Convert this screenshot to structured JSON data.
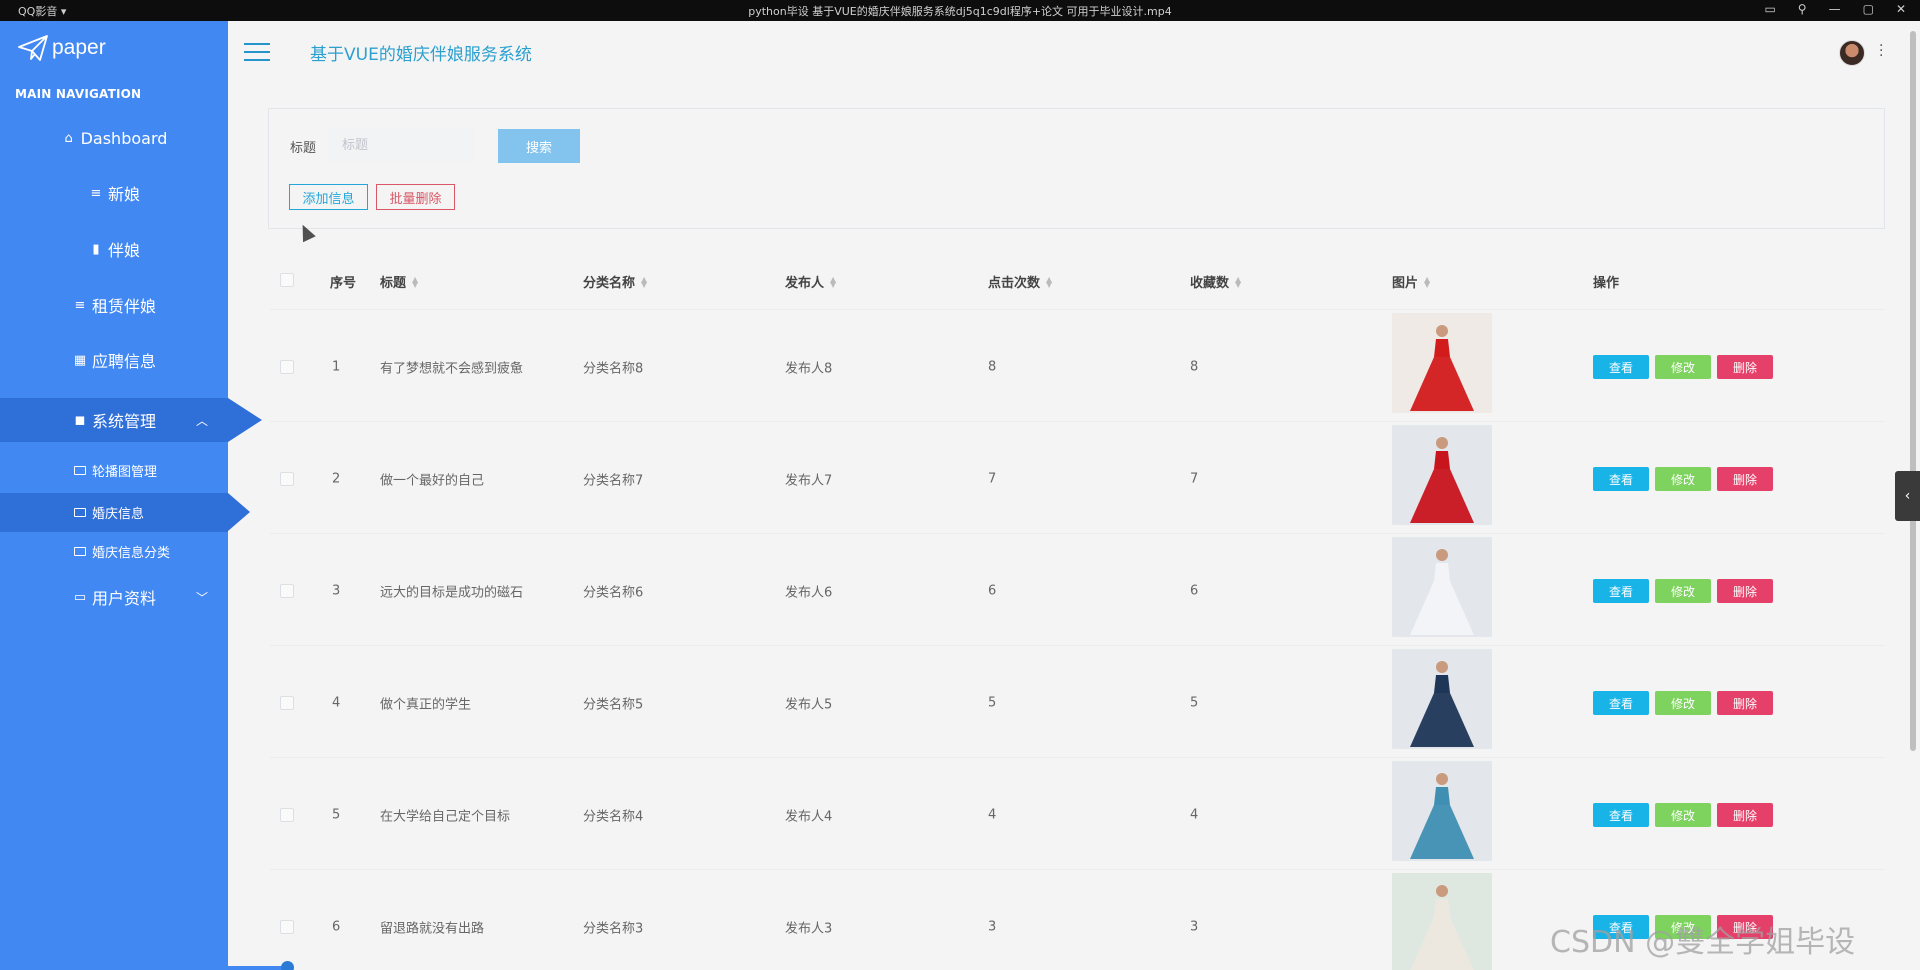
{
  "titlebar": {
    "app": "QQ影音 ▾",
    "file": "python毕设 基于VUE的婚庆伴娘服务系统dj5q1c9dl程序+论文 可用于毕业设计.mp4"
  },
  "sidebar": {
    "brand": "paper",
    "nav_label": "MAIN NAVIGATION",
    "items": [
      {
        "label": "Dashboard"
      },
      {
        "label": "新娘"
      },
      {
        "label": "伴娘"
      },
      {
        "label": "租赁伴娘"
      },
      {
        "label": "应聘信息"
      },
      {
        "label": "系统管理"
      },
      {
        "label": "用户资料"
      }
    ],
    "sub_items": [
      {
        "label": "轮播图管理"
      },
      {
        "label": "婚庆信息"
      },
      {
        "label": "婚庆信息分类"
      }
    ]
  },
  "header": {
    "title": "基于VUE的婚庆伴娘服务系统"
  },
  "search": {
    "label": "标题",
    "placeholder": "标题",
    "search_button": "搜索",
    "add_button": "添加信息",
    "batch_delete_button": "批量删除"
  },
  "table": {
    "columns": [
      "序号",
      "标题",
      "分类名称",
      "发布人",
      "点击次数",
      "收藏数",
      "图片",
      "操作"
    ],
    "action_labels": {
      "view": "查看",
      "edit": "修改",
      "delete": "删除"
    },
    "rows": [
      {
        "index": "1",
        "title": "有了梦想就不会感到疲惫",
        "category": "分类名称8",
        "publisher": "发布人8",
        "clicks": "8",
        "favorites": "8",
        "dress_color": "#d21b1b"
      },
      {
        "index": "2",
        "title": "做一个最好的自己",
        "category": "分类名称7",
        "publisher": "发布人7",
        "clicks": "7",
        "favorites": "7",
        "dress_color": "#c8141d"
      },
      {
        "index": "3",
        "title": "远大的目标是成功的磁石",
        "category": "分类名称6",
        "publisher": "发布人6",
        "clicks": "6",
        "favorites": "6",
        "dress_color": "#f2f4f8"
      },
      {
        "index": "4",
        "title": "做个真正的学生",
        "category": "分类名称5",
        "publisher": "发布人5",
        "clicks": "5",
        "favorites": "5",
        "dress_color": "#1e3658"
      },
      {
        "index": "5",
        "title": "在大学给自己定个目标",
        "category": "分类名称4",
        "publisher": "发布人4",
        "clicks": "4",
        "favorites": "4",
        "dress_color": "#3f8fb3"
      },
      {
        "index": "6",
        "title": "留退路就没有出路",
        "category": "分类名称3",
        "publisher": "发布人3",
        "clicks": "3",
        "favorites": "3",
        "dress_color": "#ece8df"
      }
    ]
  },
  "watermark": "CSDN @雙全学姐毕设",
  "colors": {
    "sidebar": "#4288f2",
    "sidebar_active": "#2f6fd8",
    "accent": "#2ba0cf",
    "view": "#18b4e8",
    "edit": "#7dd35e",
    "delete": "#e5406a"
  }
}
